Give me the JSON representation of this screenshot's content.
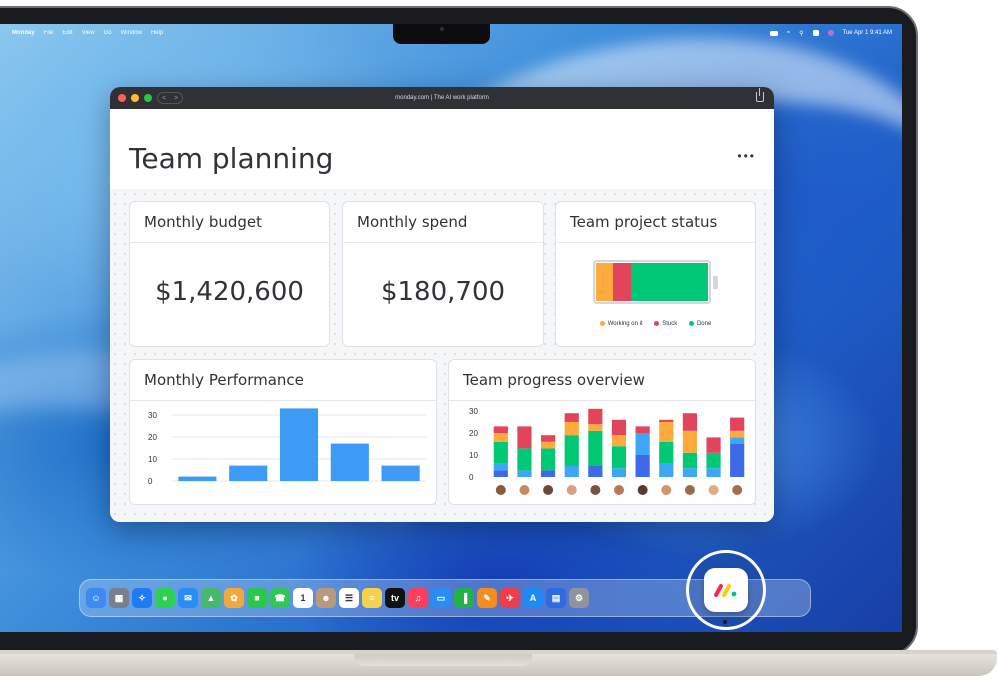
{
  "menubar": {
    "app_name": "Monday",
    "items": [
      "File",
      "Edit",
      "View",
      "Go",
      "Window",
      "Help"
    ],
    "datetime": "Tue Apr 1  9:41 AM"
  },
  "browser": {
    "url_title": "monday.com | The AI work platform",
    "back_glyph": "<",
    "forward_glyph": ">"
  },
  "page": {
    "title": "Team planning",
    "more_glyph": "•••"
  },
  "cards": {
    "budget": {
      "title": "Monthly budget",
      "value": "$1,420,600"
    },
    "spend": {
      "title": "Monthly spend",
      "value": "$180,700"
    },
    "status": {
      "title": "Team project status",
      "legend": [
        {
          "label": "Working on it",
          "color": "#fdab3d"
        },
        {
          "label": "Stuck",
          "color": "#e2445c"
        },
        {
          "label": "Done",
          "color": "#00c875"
        }
      ],
      "shares": [
        0.15,
        0.16,
        0.69
      ]
    },
    "performance": {
      "title": "Monthly Performance"
    },
    "progress": {
      "title": "Team progress overview"
    }
  },
  "chart_data": [
    {
      "type": "bar",
      "ylim": [
        0,
        30
      ],
      "yticks": [
        "0",
        "10",
        "20",
        "30"
      ],
      "values": [
        2,
        7,
        33,
        17,
        7
      ],
      "color": "#3d9af5"
    },
    {
      "type": "bar",
      "stacked": true,
      "ylim": [
        0,
        30
      ],
      "yticks": [
        "0",
        "10",
        "20",
        "30"
      ],
      "colors": [
        "#3d6be8",
        "#3da7f5",
        "#00c875",
        "#fdab3d",
        "#e2445c"
      ],
      "stacks": [
        [
          3,
          3,
          10,
          4,
          3
        ],
        [
          0,
          3,
          10,
          0,
          10
        ],
        [
          3,
          0,
          10,
          3,
          3
        ],
        [
          0,
          5,
          14,
          6,
          4
        ],
        [
          5,
          0,
          16,
          3,
          7
        ],
        [
          0,
          4,
          10,
          5,
          7
        ],
        [
          10,
          10,
          0,
          0,
          3
        ],
        [
          0,
          6,
          10,
          9,
          1
        ],
        [
          0,
          4,
          7,
          10,
          8
        ],
        [
          0,
          4,
          7,
          0,
          7
        ],
        [
          15,
          3,
          0,
          3,
          6
        ]
      ]
    }
  ],
  "dock": {
    "apps": [
      {
        "name": "finder",
        "color": "#3d8bf0",
        "glyph": "☺"
      },
      {
        "name": "launchpad",
        "color": "#7a7f8c",
        "glyph": "▦"
      },
      {
        "name": "safari",
        "color": "#1e7bf3",
        "glyph": "✧"
      },
      {
        "name": "messages",
        "color": "#2fcf55",
        "glyph": "●"
      },
      {
        "name": "mail",
        "color": "#2a8cf5",
        "glyph": "✉"
      },
      {
        "name": "maps",
        "color": "#48b96a",
        "glyph": "▲"
      },
      {
        "name": "photos",
        "color": "#f3a83a",
        "glyph": "✿"
      },
      {
        "name": "facetime",
        "color": "#28c84a",
        "glyph": "■"
      },
      {
        "name": "phone",
        "color": "#2fc857",
        "glyph": "☎"
      },
      {
        "name": "calendar",
        "color": "#ffffff",
        "glyph": "1"
      },
      {
        "name": "contacts",
        "color": "#b79a7c",
        "glyph": "☻"
      },
      {
        "name": "reminders",
        "color": "#ffffff",
        "glyph": "☰"
      },
      {
        "name": "notes",
        "color": "#f6d24a",
        "glyph": "≡"
      },
      {
        "name": "tv",
        "color": "#111111",
        "glyph": "tv"
      },
      {
        "name": "music",
        "color": "#f8405a",
        "glyph": "♫"
      },
      {
        "name": "keynote",
        "color": "#2b8cf3",
        "glyph": "▭"
      },
      {
        "name": "numbers",
        "color": "#23b14a",
        "glyph": "▐"
      },
      {
        "name": "pages",
        "color": "#f38d1e",
        "glyph": "✎"
      },
      {
        "name": "rocket",
        "color": "#ef3d4b",
        "glyph": "✈"
      },
      {
        "name": "app-store",
        "color": "#1e8bf5",
        "glyph": "A"
      },
      {
        "name": "preview",
        "color": "#2e6be0",
        "glyph": "▤"
      },
      {
        "name": "settings",
        "color": "#8f949c",
        "glyph": "⚙"
      }
    ],
    "featured": "monday"
  }
}
